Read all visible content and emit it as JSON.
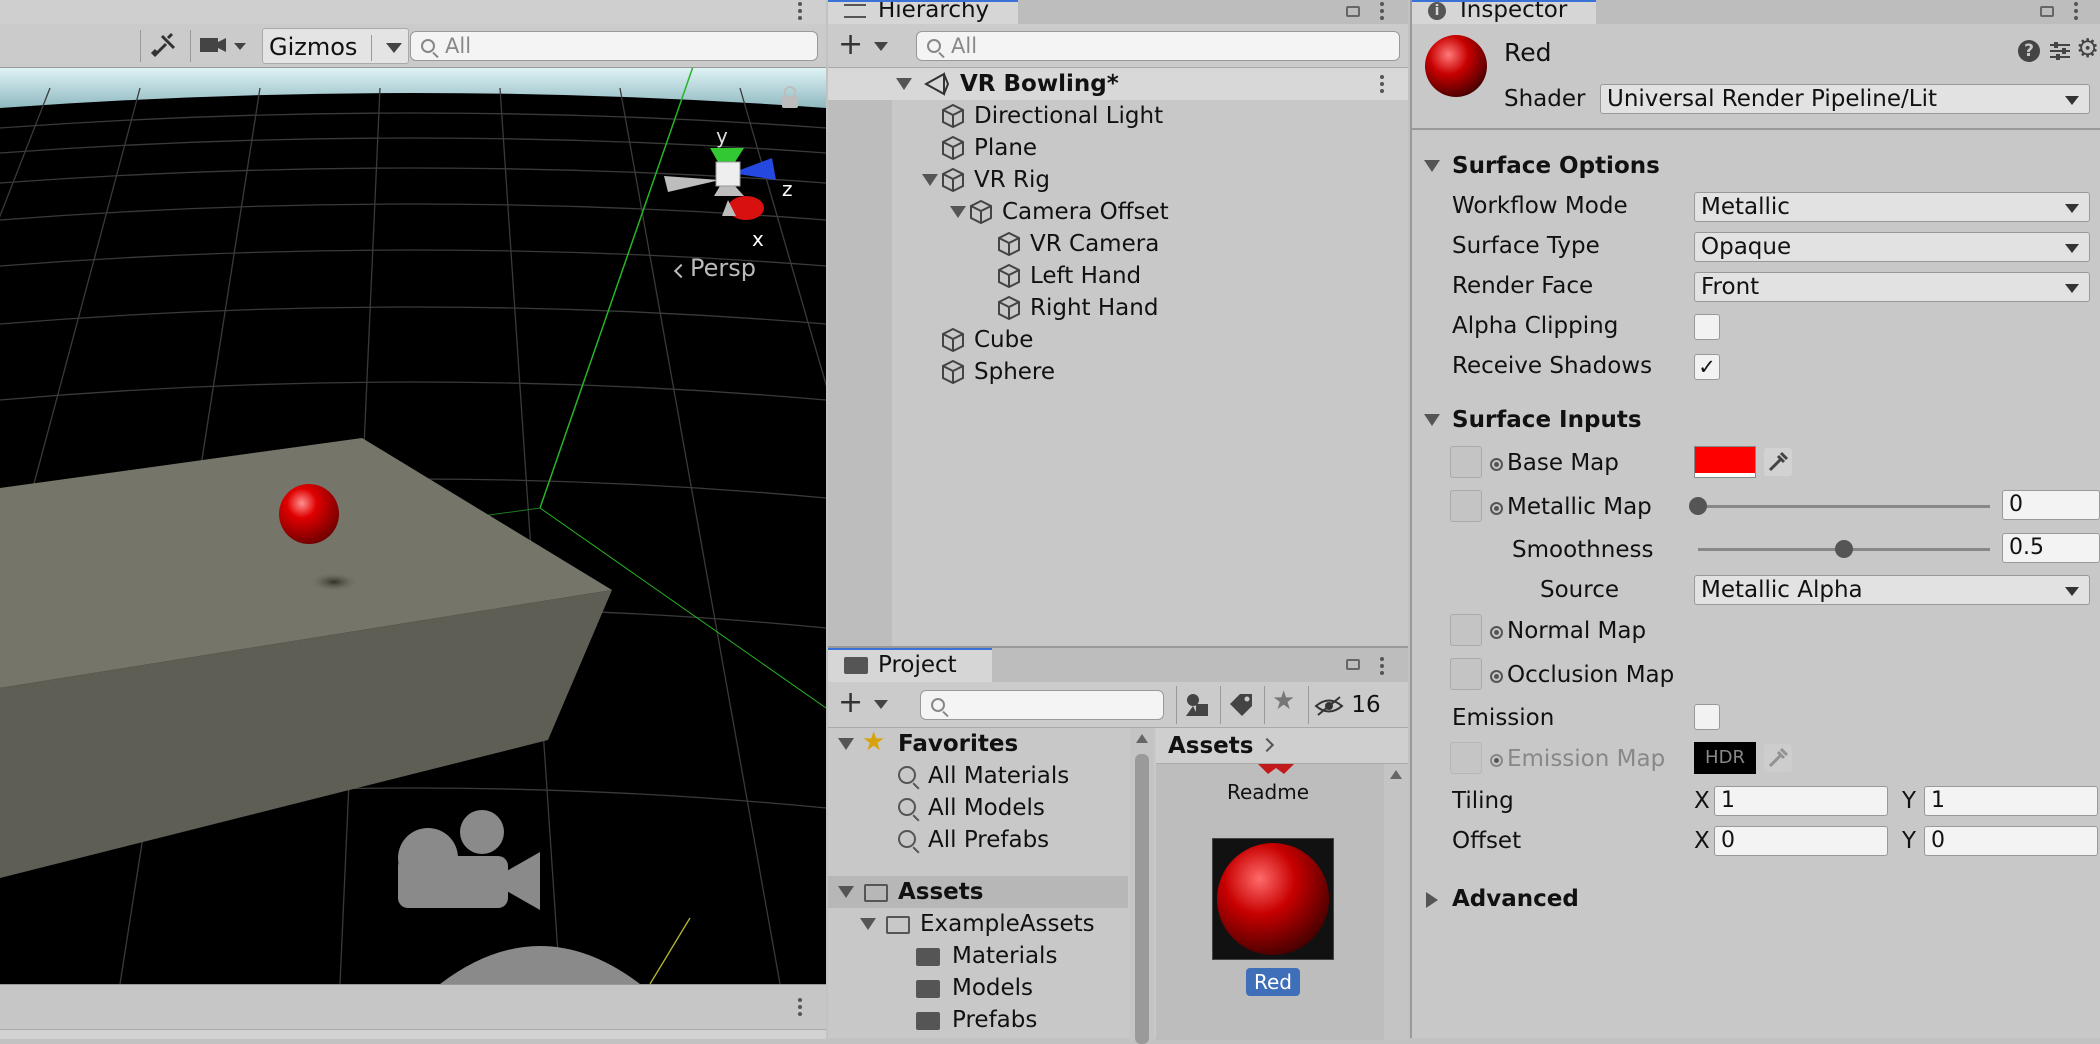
{
  "scene": {
    "gizmos_label": "Gizmos",
    "search_placeholder": "All",
    "persp_label": "Persp",
    "axis_y": "y",
    "axis_z": "z",
    "axis_x": "x"
  },
  "hierarchy": {
    "tab_label": "Hierarchy",
    "search_placeholder": "All",
    "scene_name": "VR Bowling*",
    "items": [
      {
        "label": "Directional Light"
      },
      {
        "label": "Plane"
      },
      {
        "label": "VR Rig"
      },
      {
        "label": "Camera Offset"
      },
      {
        "label": "VR Camera"
      },
      {
        "label": "Left Hand"
      },
      {
        "label": "Right Hand"
      },
      {
        "label": "Cube"
      },
      {
        "label": "Sphere"
      }
    ]
  },
  "project": {
    "tab_label": "Project",
    "hidden_count": "16",
    "favorites_label": "Favorites",
    "favorites": [
      {
        "label": "All Materials"
      },
      {
        "label": "All Models"
      },
      {
        "label": "All Prefabs"
      }
    ],
    "assets_label": "Assets",
    "folders": [
      {
        "label": "ExampleAssets"
      },
      {
        "label": "Materials"
      },
      {
        "label": "Models"
      },
      {
        "label": "Prefabs"
      }
    ],
    "breadcrumb": "Assets",
    "asset_readme": "Readme",
    "asset_red": "Red"
  },
  "inspector": {
    "tab_label": "Inspector",
    "material_name": "Red",
    "shader_label": "Shader",
    "shader_value": "Universal Render Pipeline/Lit",
    "surface_options": {
      "title": "Surface Options",
      "workflow_mode_label": "Workflow Mode",
      "workflow_mode_value": "Metallic",
      "surface_type_label": "Surface Type",
      "surface_type_value": "Opaque",
      "render_face_label": "Render Face",
      "render_face_value": "Front",
      "alpha_clipping_label": "Alpha Clipping",
      "alpha_clipping_checked": false,
      "receive_shadows_label": "Receive Shadows",
      "receive_shadows_checkmark": "✓"
    },
    "surface_inputs": {
      "title": "Surface Inputs",
      "base_map_label": "Base Map",
      "base_color": "#ff0000",
      "metallic_map_label": "Metallic Map",
      "metallic_value": "0",
      "metallic_fraction": 0.0,
      "smoothness_label": "Smoothness",
      "smoothness_value": "0.5",
      "smoothness_fraction": 0.5,
      "source_label": "Source",
      "source_value": "Metallic Alpha",
      "normal_map_label": "Normal Map",
      "occlusion_map_label": "Occlusion Map",
      "emission_label": "Emission",
      "emission_map_label": "Emission Map",
      "hdr_label": "HDR",
      "tiling_label": "Tiling",
      "tiling_x": "1",
      "tiling_y": "1",
      "offset_label": "Offset",
      "offset_x": "0",
      "offset_y": "0",
      "x_label": "X",
      "y_label": "Y"
    },
    "advanced_title": "Advanced"
  },
  "colors": {
    "accent": "#3a72d8",
    "sphere_red": "#d40000",
    "selection_blue": "#3e6fb8"
  }
}
